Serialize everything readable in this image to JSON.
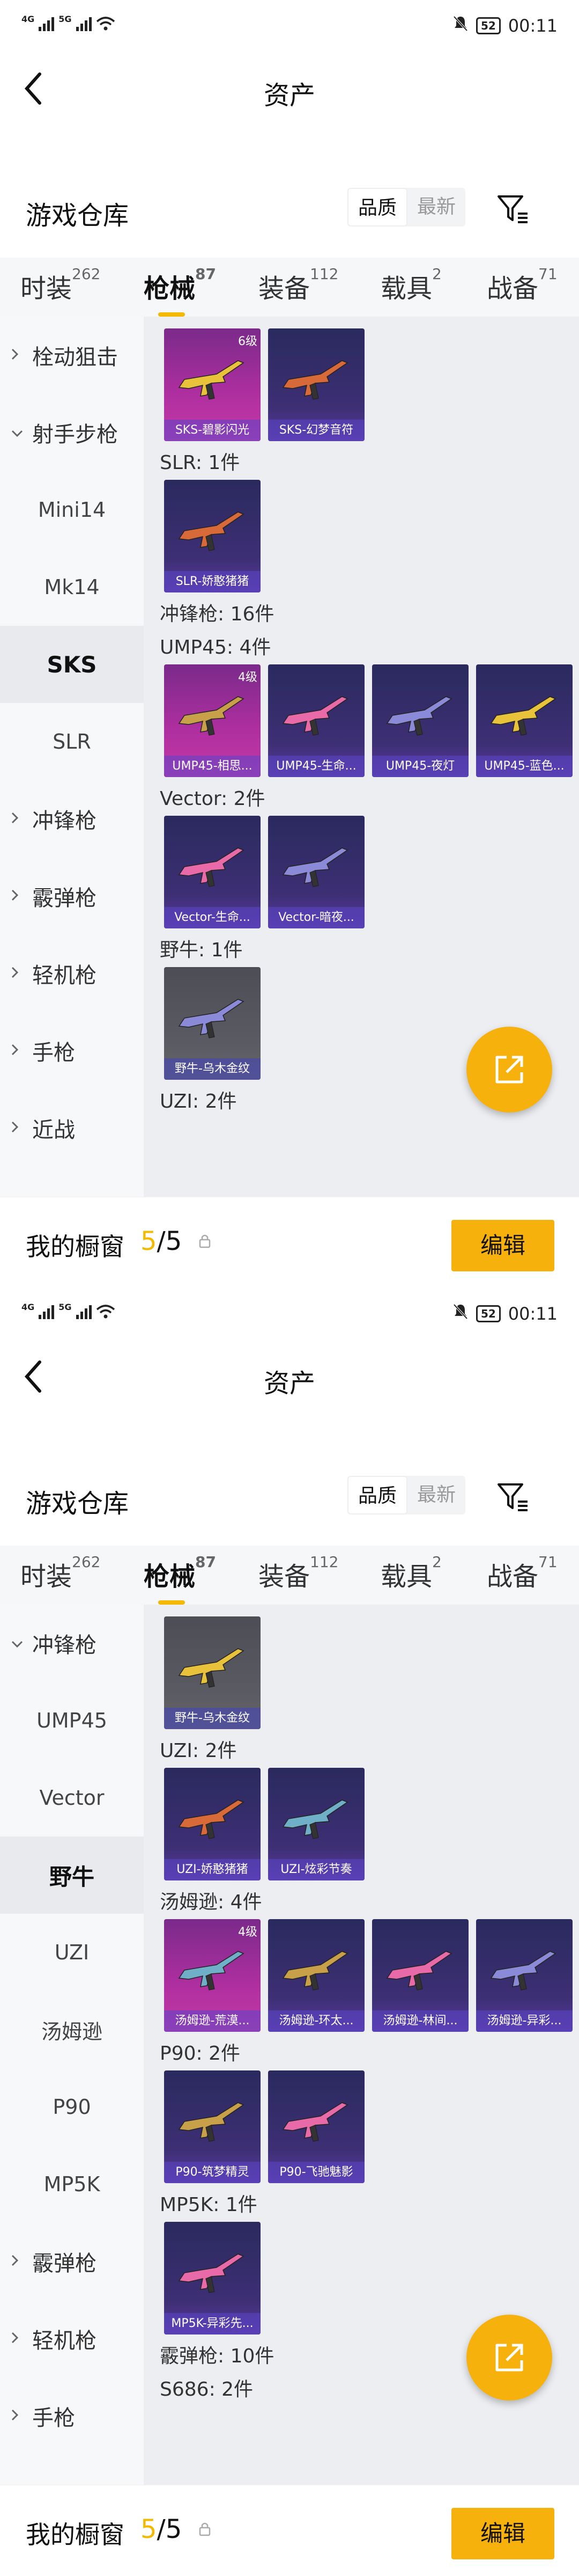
{
  "status": {
    "net": "4G",
    "net2": "5G",
    "battery": "52",
    "time": "00:11"
  },
  "header": {
    "title": "资产"
  },
  "warehouse": {
    "title": "游戏仓库",
    "sort_quality": "品质",
    "sort_new": "最新"
  },
  "tabs": [
    {
      "label": "时装",
      "count": "262"
    },
    {
      "label": "枪械",
      "count": "87"
    },
    {
      "label": "装备",
      "count": "112"
    },
    {
      "label": "载具",
      "count": "2"
    },
    {
      "label": "战备",
      "count": "71"
    }
  ],
  "screen1": {
    "sidebar": [
      {
        "label": "栓动狙击",
        "kind": "parent",
        "open": false
      },
      {
        "label": "射手步枪",
        "kind": "parent",
        "open": true
      },
      {
        "label": "Mini14",
        "kind": "child"
      },
      {
        "label": "Mk14",
        "kind": "child"
      },
      {
        "label": "SKS",
        "kind": "child",
        "selected": true
      },
      {
        "label": "SLR",
        "kind": "child"
      },
      {
        "label": "冲锋枪",
        "kind": "parent",
        "open": false
      },
      {
        "label": "霰弹枪",
        "kind": "parent",
        "open": false
      },
      {
        "label": "轻机枪",
        "kind": "parent",
        "open": false
      },
      {
        "label": "手枪",
        "kind": "parent",
        "open": false
      },
      {
        "label": "近战",
        "kind": "parent",
        "open": false
      }
    ],
    "sections": [
      {
        "label": "",
        "items": [
          {
            "name": "SKS-碧影闪光",
            "level": "6级",
            "style": "pink"
          },
          {
            "name": "SKS-幻梦音符",
            "style": "blue"
          }
        ]
      },
      {
        "label": "SLR: 1件",
        "items": [
          {
            "name": "SLR-娇憨猪猪",
            "style": "blue"
          }
        ]
      },
      {
        "label": "冲锋枪: 16件",
        "items": []
      },
      {
        "label": "UMP45: 4件",
        "items": [
          {
            "name": "UMP45-相思...",
            "level": "4级",
            "style": "pink"
          },
          {
            "name": "UMP45-生命...",
            "style": "blue"
          },
          {
            "name": "UMP45-夜灯",
            "style": "blue"
          },
          {
            "name": "UMP45-蓝色...",
            "style": "blue"
          }
        ]
      },
      {
        "label": "Vector: 2件",
        "items": [
          {
            "name": "Vector-生命...",
            "style": "blue"
          },
          {
            "name": "Vector-暗夜...",
            "style": "blue"
          }
        ]
      },
      {
        "label": "野牛: 1件",
        "items": [
          {
            "name": "野牛-乌木金纹",
            "style": "gray"
          }
        ]
      },
      {
        "label": "UZI: 2件",
        "items": []
      }
    ]
  },
  "screen2": {
    "sidebar": [
      {
        "label": "冲锋枪",
        "kind": "parent",
        "open": true
      },
      {
        "label": "UMP45",
        "kind": "child"
      },
      {
        "label": "Vector",
        "kind": "child"
      },
      {
        "label": "野牛",
        "kind": "child",
        "selected": true
      },
      {
        "label": "UZI",
        "kind": "child"
      },
      {
        "label": "汤姆逊",
        "kind": "child"
      },
      {
        "label": "P90",
        "kind": "child"
      },
      {
        "label": "MP5K",
        "kind": "child"
      },
      {
        "label": "霰弹枪",
        "kind": "parent",
        "open": false
      },
      {
        "label": "轻机枪",
        "kind": "parent",
        "open": false
      },
      {
        "label": "手枪",
        "kind": "parent",
        "open": false
      }
    ],
    "sections": [
      {
        "label": "",
        "items": [
          {
            "name": "野牛-乌木金纹",
            "style": "gray"
          }
        ]
      },
      {
        "label": "UZI: 2件",
        "items": [
          {
            "name": "UZI-娇憨猪猪",
            "style": "blue"
          },
          {
            "name": "UZI-炫彩节奏",
            "style": "blue"
          }
        ]
      },
      {
        "label": "汤姆逊: 4件",
        "items": [
          {
            "name": "汤姆逊-荒漠...",
            "level": "4级",
            "style": "pink"
          },
          {
            "name": "汤姆逊-环太...",
            "style": "blue"
          },
          {
            "name": "汤姆逊-林间...",
            "style": "blue"
          },
          {
            "name": "汤姆逊-异彩...",
            "style": "blue"
          }
        ]
      },
      {
        "label": "P90: 2件",
        "items": [
          {
            "name": "P90-筑梦精灵",
            "style": "blue"
          },
          {
            "name": "P90-飞驰魅影",
            "style": "blue"
          }
        ]
      },
      {
        "label": "MP5K: 1件",
        "items": [
          {
            "name": "MP5K-异彩先...",
            "style": "blue"
          }
        ]
      },
      {
        "label": "霰弹枪: 10件",
        "items": []
      },
      {
        "label": "S686: 2件",
        "items": []
      }
    ]
  },
  "bottom": {
    "label": "我的橱窗",
    "current": "5",
    "total": "/5",
    "edit": "编辑"
  }
}
